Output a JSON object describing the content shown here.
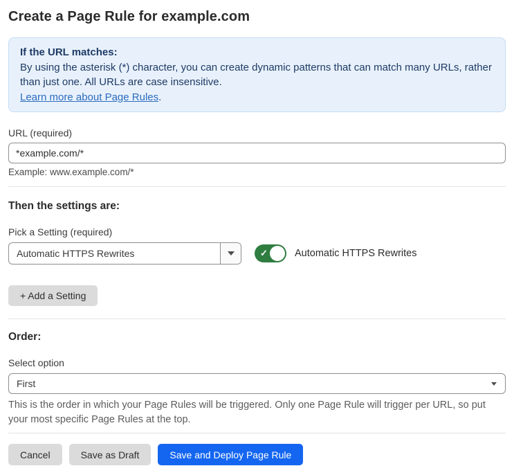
{
  "page": {
    "title": "Create a Page Rule for example.com"
  },
  "info_box": {
    "heading": "If the URL matches:",
    "body": "By using the asterisk (*) character, you can create dynamic patterns that can match many URLs, rather than just one. All URLs are case insensitive.",
    "link_label": "Learn more about Page Rules",
    "link_suffix": "."
  },
  "url_field": {
    "label": "URL (required)",
    "value": "*example.com/*",
    "helper": "Example: www.example.com/*"
  },
  "settings_section": {
    "heading": "Then the settings are:",
    "picker_label": "Pick a Setting (required)",
    "picker_value": "Automatic HTTPS Rewrites",
    "toggle_state": "on",
    "toggle_check": "✓",
    "toggle_label": "Automatic HTTPS Rewrites",
    "add_button_label": "+ Add a Setting"
  },
  "order_section": {
    "heading": "Order:",
    "select_label": "Select option",
    "select_value": "First",
    "help_text": "This is the order in which your Page Rules will be triggered. Only one Page Rule will trigger per URL, so put your most specific Page Rules at the top."
  },
  "footer": {
    "cancel_label": "Cancel",
    "save_draft_label": "Save as Draft",
    "save_deploy_label": "Save and Deploy Page Rule"
  },
  "colors": {
    "info_bg": "#e8f1fb",
    "info_border": "#c3dcf3",
    "info_text": "#1e3a66",
    "link_blue": "#2c6bbf",
    "toggle_green": "#2f7d40",
    "primary_blue": "#1466f0",
    "button_gray": "#dbdbdb"
  }
}
